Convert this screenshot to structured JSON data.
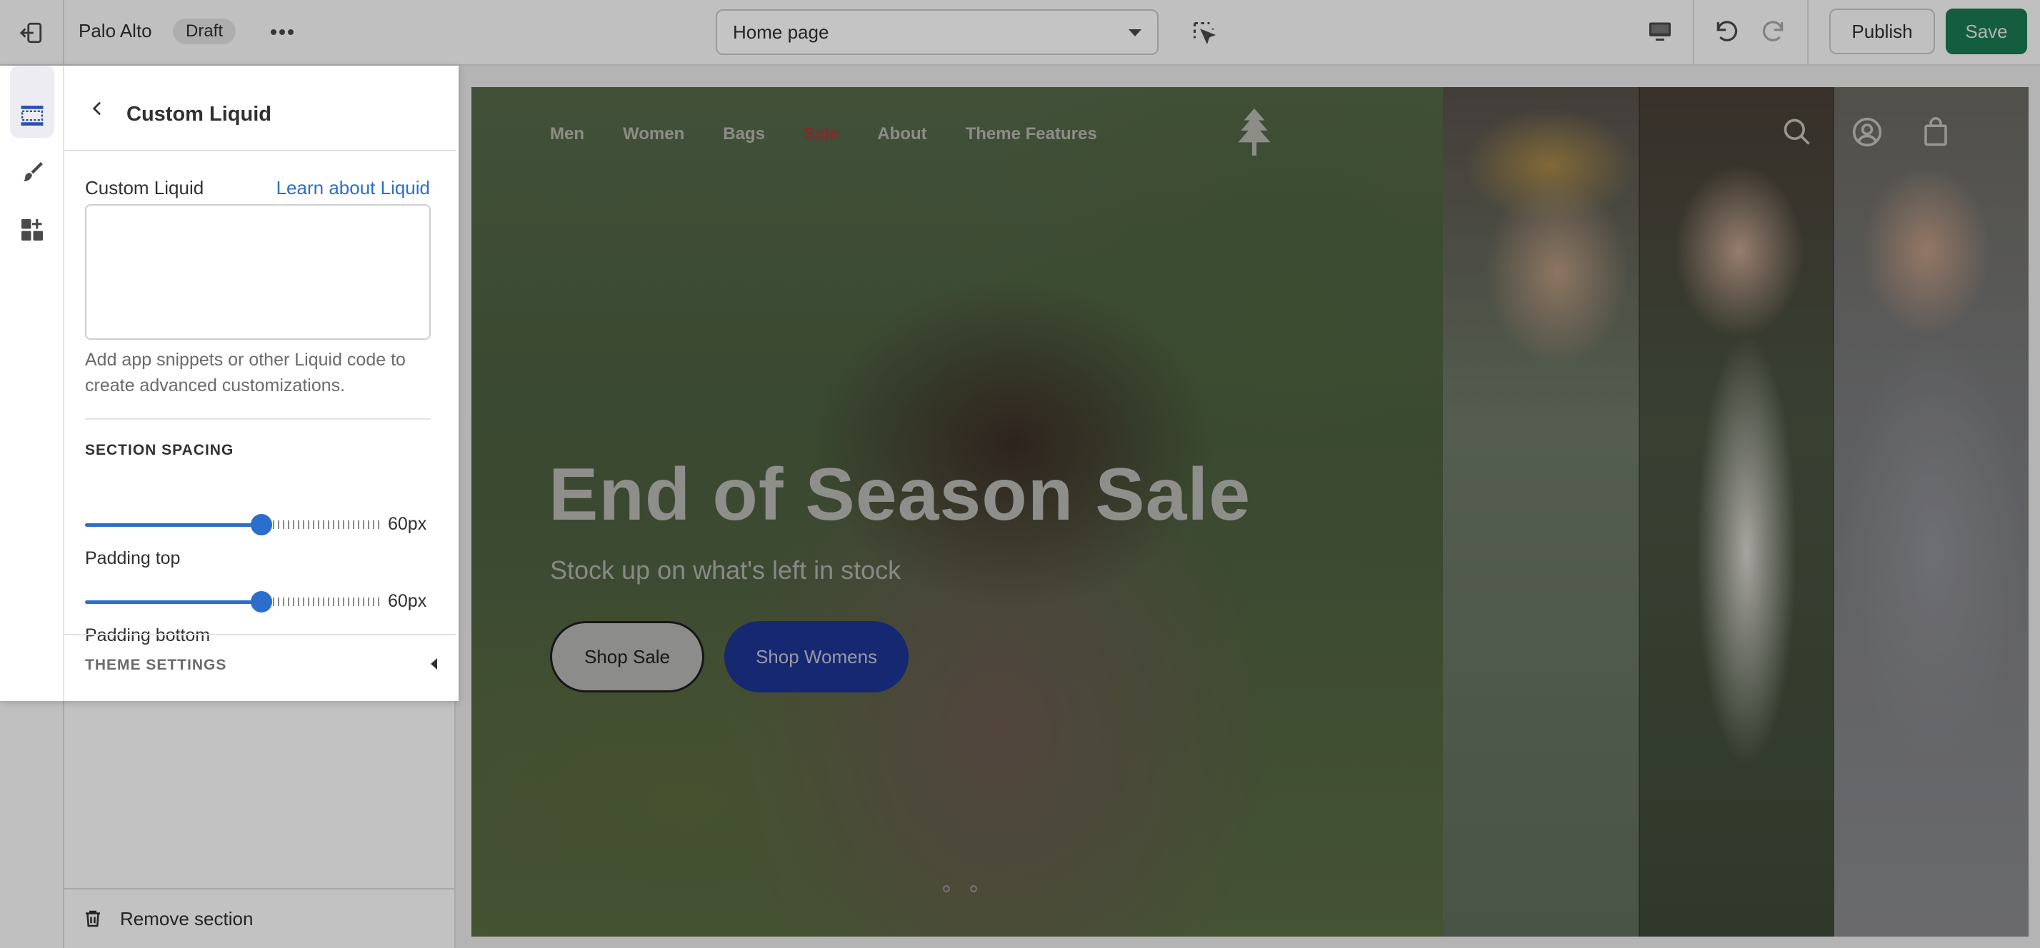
{
  "topbar": {
    "store_name": "Palo Alto",
    "status_badge": "Draft",
    "page_selector_value": "Home page",
    "publish_label": "Publish",
    "save_label": "Save"
  },
  "sidebar": {
    "remove_section_label": "Remove section"
  },
  "panel": {
    "title": "Custom Liquid",
    "field_label": "Custom Liquid",
    "learn_link": "Learn about Liquid",
    "code_value": "",
    "help_text": "Add app snippets or other Liquid code to create advanced customizations.",
    "section_heading": "SECTION SPACING",
    "padding_top": {
      "label": "Padding top",
      "value": "60px",
      "fraction": 0.6
    },
    "padding_bottom": {
      "label": "Padding bottom",
      "value": "60px",
      "fraction": 0.6
    },
    "theme_settings_label": "THEME SETTINGS"
  },
  "preview": {
    "nav_items": [
      "Men",
      "Women",
      "Bags",
      "Sale",
      "About",
      "Theme Features"
    ],
    "hero_title": "End of Season Sale",
    "hero_subtitle": "Stock up on what's left in stock",
    "button_primary": "Shop Sale",
    "button_secondary": "Shop Womens",
    "slide_count": 2
  },
  "colors": {
    "accent_blue": "#2c6ecb",
    "save_green": "#1a7a52",
    "sale_red": "#a83a3a",
    "shop_womens_blue": "#1c3593"
  },
  "icons": {
    "exit": "exit-icon",
    "more": "more-horizontal-icon",
    "inspect": "inspect-cursor-icon",
    "device": "desktop-icon",
    "undo": "undo-icon",
    "redo": "redo-icon",
    "sections": "sections-icon",
    "theme": "paintbrush-icon",
    "apps": "apps-icon",
    "back": "chevron-left-icon",
    "trash": "trash-icon",
    "search": "search-icon",
    "account": "account-icon",
    "cart": "bag-icon",
    "logo": "tree-logo-icon"
  }
}
